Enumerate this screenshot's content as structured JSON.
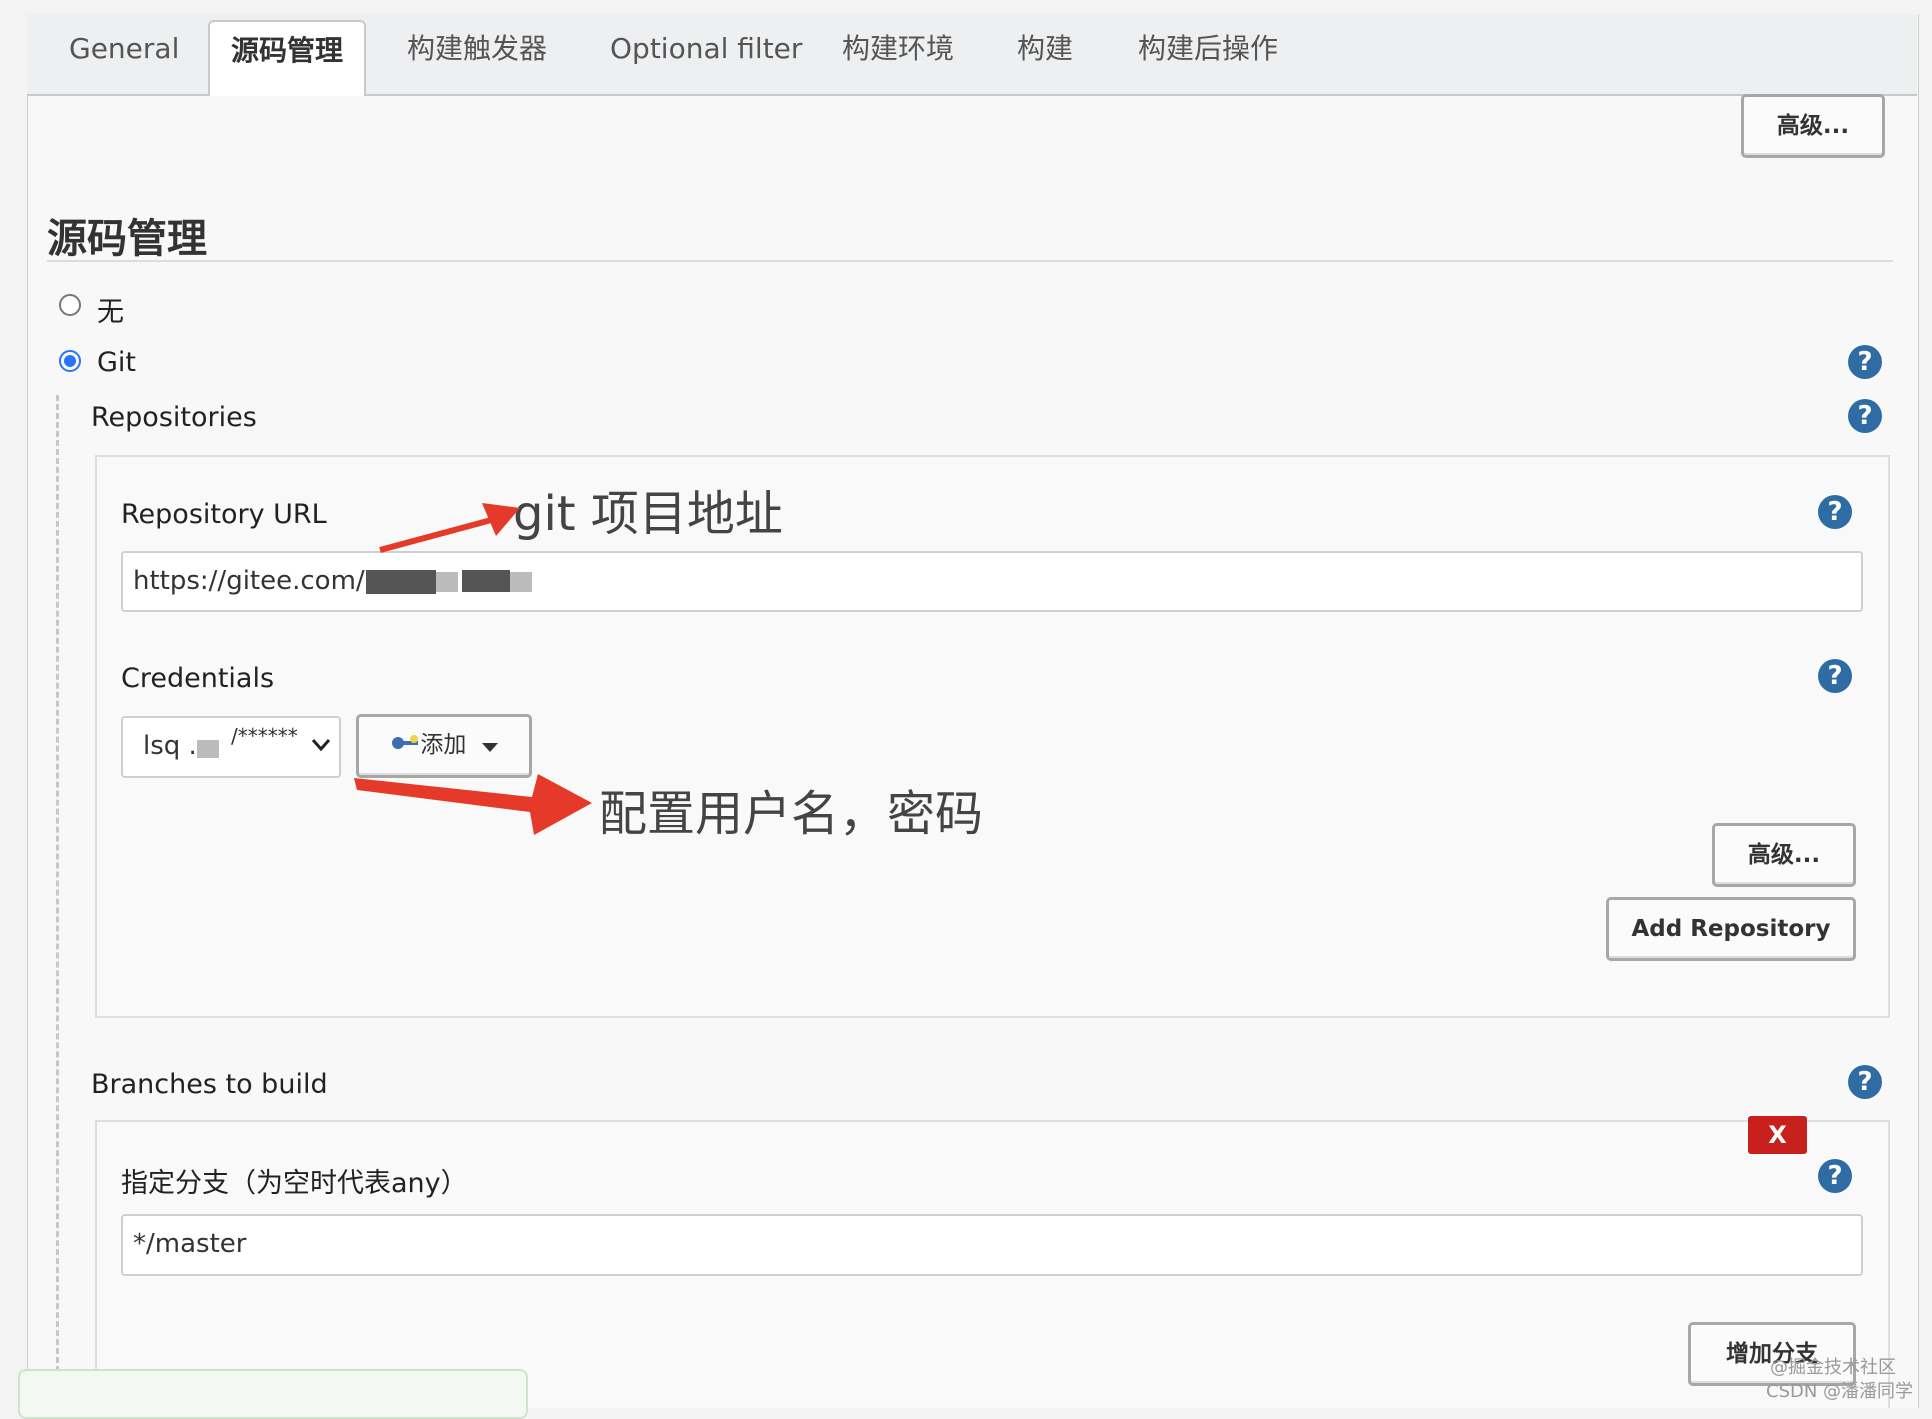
{
  "tabs": [
    {
      "label": "General"
    },
    {
      "label": "源码管理"
    },
    {
      "label": "构建触发器"
    },
    {
      "label": "Optional filter"
    },
    {
      "label": "构建环境"
    },
    {
      "label": "构建"
    },
    {
      "label": "构建后操作"
    }
  ],
  "toolbar": {
    "advanced_label": "高级..."
  },
  "section": {
    "title": "源码管理"
  },
  "scm": {
    "option_none": "无",
    "option_git": "Git"
  },
  "repositories": {
    "title": "Repositories",
    "url_label": "Repository URL",
    "url_value": "https://gitee.com/.",
    "credentials_label": "Credentials",
    "credentials_value": "lsq .",
    "credentials_masked": "/******",
    "add_label": "添加",
    "advanced_label": "高级...",
    "add_repo_label": "Add Repository"
  },
  "branches": {
    "title": "Branches to build",
    "spec_label": "指定分支（为空时代表any）",
    "spec_value": "*/master",
    "delete_label": "X",
    "add_branch_label": "增加分支"
  },
  "annotations": {
    "url_note": "git  项目地址",
    "cred_note": "配置用户名，密码"
  },
  "help_label": "?",
  "watermark": {
    "line1": "@掘金技术社区",
    "line2": "CSDN @潘潘同学"
  },
  "colors": {
    "help": "#2e6ca3",
    "arrow": "#e53a2a",
    "delete": "#c8201c",
    "radio": "#2a74ff"
  }
}
